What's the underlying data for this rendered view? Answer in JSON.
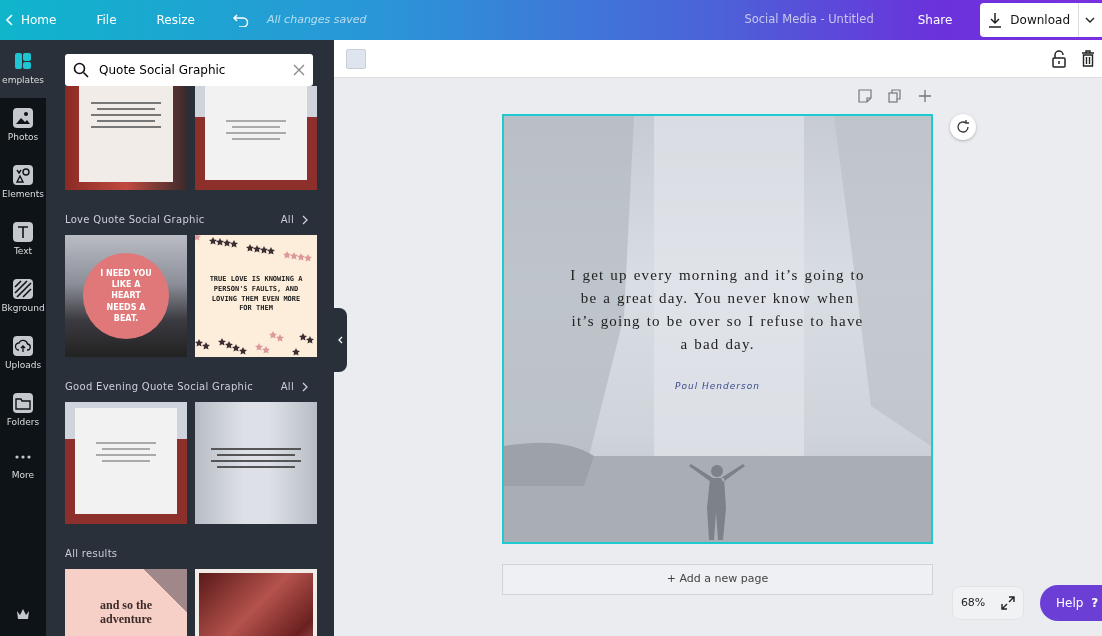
{
  "topbar": {
    "back": "Home",
    "menu": [
      "File",
      "Resize"
    ],
    "status": "All changes saved",
    "title": "Social Media - Untitled",
    "share": "Share",
    "download": "Download"
  },
  "rail": [
    {
      "label": "emplates",
      "kind": "templates",
      "selected": true
    },
    {
      "label": "Photos",
      "kind": "photos",
      "selected": false
    },
    {
      "label": "Elements",
      "kind": "elements",
      "selected": false
    },
    {
      "label": "Text",
      "kind": "text",
      "selected": false
    },
    {
      "label": "Bkground",
      "kind": "background",
      "selected": false
    },
    {
      "label": "Uploads",
      "kind": "uploads",
      "selected": false
    },
    {
      "label": "Folders",
      "kind": "folders",
      "selected": false
    },
    {
      "label": "More",
      "kind": "more",
      "selected": false
    }
  ],
  "search": {
    "value": "Quote Social Graphic"
  },
  "sections": [
    {
      "templates": [
        {
          "kind": "red-quote"
        },
        {
          "kind": "white-quote"
        }
      ]
    },
    {
      "title": "Love Quote Social Graphic",
      "link": "All",
      "templates": [
        {
          "kind": "circle",
          "text": "I NEED YOU LIKE A HEART NEEDS A BEAT."
        },
        {
          "kind": "stars",
          "text": "TRUE LOVE IS KNOWING A PERSON'S FAULTS, AND LOVING THEM EVEN MORE FOR THEM"
        }
      ]
    },
    {
      "title": "Good Evening Quote Social Graphic",
      "link": "All",
      "templates": [
        {
          "kind": "white-quote"
        },
        {
          "kind": "waterfall"
        }
      ]
    },
    {
      "title": "All results",
      "templates": [
        {
          "kind": "pink",
          "text": "and so the adventure"
        },
        {
          "kind": "hair"
        }
      ]
    }
  ],
  "design": {
    "quote": "I get up every morning and it’s going to be a great day. You never know when it’s going to be over so I refuse to have a bad day.",
    "author": "Poul Henderson"
  },
  "add_page": "+ Add a new page",
  "zoom": "68%",
  "help": {
    "label": "Help",
    "mark": "?"
  }
}
